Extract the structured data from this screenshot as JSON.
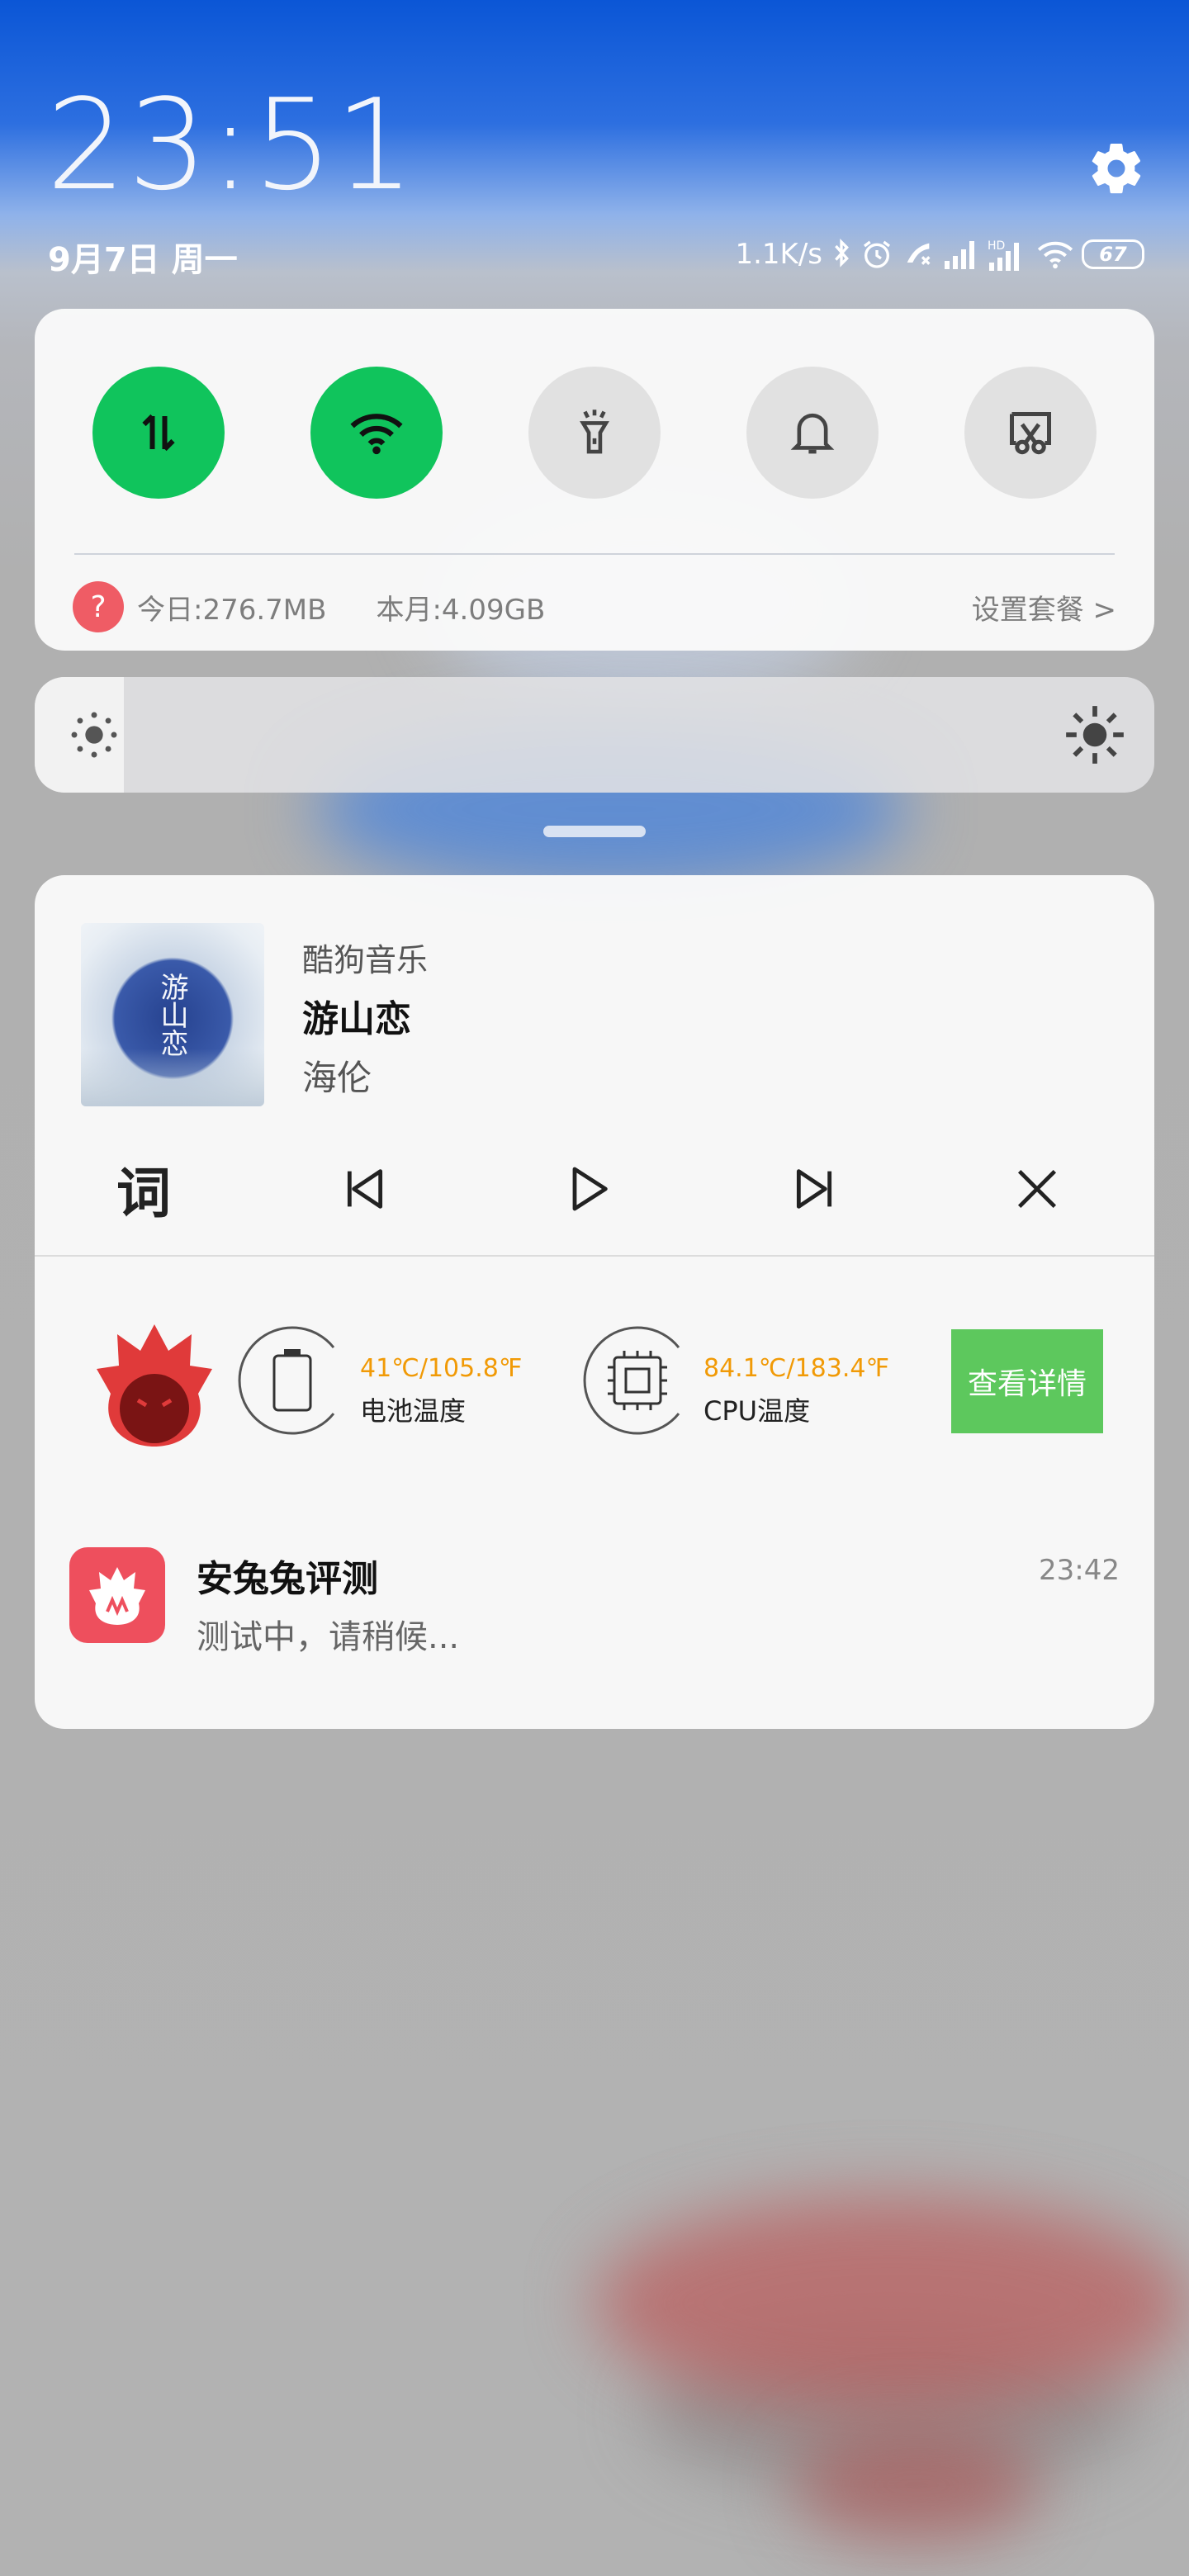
{
  "header": {
    "time": "23:51",
    "date": "9月7日 周一",
    "net_speed": "1.1K/s",
    "battery_level": "67",
    "settings_icon": "gear-icon"
  },
  "quick_settings": {
    "toggles": [
      {
        "name": "mobile-data",
        "icon": "data-arrows-icon",
        "active": true
      },
      {
        "name": "wifi",
        "icon": "wifi-icon",
        "active": true
      },
      {
        "name": "flashlight",
        "icon": "flashlight-icon",
        "active": false
      },
      {
        "name": "sound",
        "icon": "bell-icon",
        "active": false
      },
      {
        "name": "screenshot",
        "icon": "scissors-icon",
        "active": false
      }
    ],
    "usage": {
      "icon_label": "?",
      "today": "今日:276.7MB",
      "month": "本月:4.09GB",
      "plan_link": "设置套餐 >"
    },
    "active_color": "#10c45c"
  },
  "brightness": {
    "level": 0.08
  },
  "music": {
    "app": "酷狗音乐",
    "title": "游山恋",
    "artist": "海伦",
    "album_art_text": "游山恋",
    "lyric_button": "词"
  },
  "antutu_widget": {
    "battery_temp": "41℃/105.8℉",
    "battery_label": "电池温度",
    "cpu_temp": "84.1℃/183.4℉",
    "cpu_label": "CPU温度",
    "details_button": "查看详情",
    "temp_color": "#f19a06",
    "button_color": "#5dc85d"
  },
  "notification": {
    "app_name": "安兔兔评测",
    "time": "23:42",
    "message": "测试中，请稍候..."
  }
}
